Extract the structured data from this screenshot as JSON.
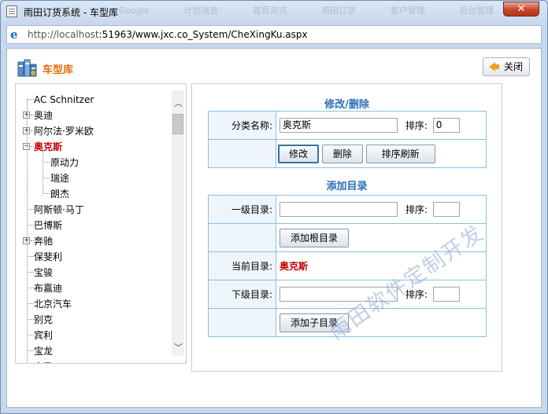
{
  "window": {
    "title": "雨田订货系统 - 车型库",
    "close_label": "✕",
    "ghost_tabs": [
      "Google",
      "计划消息",
      "首页资讯",
      "雨田订货",
      "客户管理",
      "后台管理"
    ]
  },
  "address": {
    "url_prefix": "http://localhost",
    "url_rest": ":51963/www.jxc.co_System/CheXingKu.aspx"
  },
  "header": {
    "title": "车型库",
    "close_button": "关闭"
  },
  "tree": {
    "items": [
      {
        "label": "AC Schnitzer",
        "level": 0,
        "expander": ""
      },
      {
        "label": "奥迪",
        "level": 0,
        "expander": "+"
      },
      {
        "label": "阿尔法·罗米欧",
        "level": 0,
        "expander": "+"
      },
      {
        "label": "奥克斯",
        "level": 0,
        "expander": "−",
        "selected": true
      },
      {
        "label": "原动力",
        "level": 1,
        "expander": ""
      },
      {
        "label": "瑞途",
        "level": 1,
        "expander": ""
      },
      {
        "label": "朗杰",
        "level": 1,
        "expander": ""
      },
      {
        "label": "阿斯顿·马丁",
        "level": 0,
        "expander": ""
      },
      {
        "label": "巴博斯",
        "level": 0,
        "expander": ""
      },
      {
        "label": "奔驰",
        "level": 0,
        "expander": "+"
      },
      {
        "label": "保斐利",
        "level": 0,
        "expander": ""
      },
      {
        "label": "宝骏",
        "level": 0,
        "expander": ""
      },
      {
        "label": "布嘉迪",
        "level": 0,
        "expander": ""
      },
      {
        "label": "北京汽车",
        "level": 0,
        "expander": ""
      },
      {
        "label": "别克",
        "level": 0,
        "expander": ""
      },
      {
        "label": "宾利",
        "level": 0,
        "expander": ""
      },
      {
        "label": "宝龙",
        "level": 0,
        "expander": ""
      },
      {
        "label": "宝马",
        "level": 0,
        "expander": ""
      }
    ],
    "scroll_up": "︿",
    "scroll_down": "﹀"
  },
  "edit_section": {
    "title": "修改/删除",
    "name_label": "分类名称:",
    "name_value": "奥克斯",
    "sort_label": "排序:",
    "sort_value": "0",
    "modify_button": "修改",
    "delete_button": "删除",
    "refresh_button": "排序刷新"
  },
  "add_section": {
    "title": "添加目录",
    "level1_label": "一级目录:",
    "level1_value": "",
    "level1_sort_label": "排序:",
    "level1_sort_value": "",
    "add_root_button": "添加根目录",
    "current_label": "当前目录:",
    "current_value": "奥克斯",
    "sub_label": "下级目录:",
    "sub_value": "",
    "sub_sort_label": "排序:",
    "sub_sort_value": "",
    "add_child_button": "添加子目录"
  },
  "watermark": "雨田软件定制开发",
  "colors": {
    "accent_orange": "#e36c09",
    "section_blue": "#2a6fb7",
    "selected_red": "#c00000",
    "table_border": "#8dc0e0"
  }
}
